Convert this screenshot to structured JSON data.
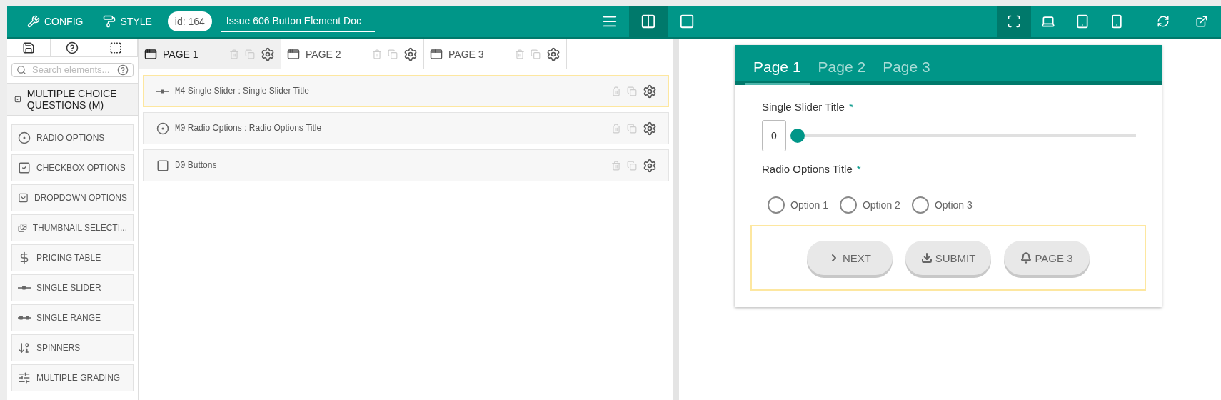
{
  "toolbar": {
    "config_label": "CONFIG",
    "style_label": "STYLE",
    "id_badge": "id: 164",
    "doc_title": "Issue 606 Button Element Doc",
    "view_buttons": [
      {
        "selected": false
      },
      {
        "selected": true
      },
      {
        "selected": false
      }
    ],
    "device_buttons": [
      {
        "selected": true
      },
      {
        "selected": false
      },
      {
        "selected": false
      },
      {
        "selected": false
      }
    ]
  },
  "sidebar": {
    "tool_buttons": [
      {
        "selected": false
      },
      {
        "selected": false
      },
      {
        "selected": false
      }
    ],
    "search_placeholder": "Search elements...",
    "category": {
      "label": "MULTIPLE CHOICE QUESTIONS (M)",
      "checked": true
    },
    "elements": [
      "RADIO OPTIONS",
      "CHECKBOX OPTIONS",
      "DROPDOWN OPTIONS",
      "THUMBNAIL SELECTI...",
      "PRICING TABLE",
      "SINGLE SLIDER",
      "SINGLE RANGE",
      "SPINNERS",
      "MULTIPLE GRADING"
    ]
  },
  "editor": {
    "tabs": [
      {
        "label": "PAGE 1",
        "selected": true
      },
      {
        "label": "PAGE 2",
        "selected": false
      },
      {
        "label": "PAGE 3",
        "selected": false
      }
    ],
    "rows": [
      {
        "code": "M4",
        "text": "Single Slider : Single Slider Title",
        "selected": true
      },
      {
        "code": "M0",
        "text": "Radio Options : Radio Options Title",
        "selected": false
      },
      {
        "code": "D0",
        "text": "Buttons",
        "selected": false
      }
    ]
  },
  "preview": {
    "tabs": [
      {
        "label": "Page 1",
        "selected": true
      },
      {
        "label": "Page 2",
        "selected": false
      },
      {
        "label": "Page 3",
        "selected": false
      }
    ],
    "slider": {
      "title": "Single Slider Title",
      "required_mark": "*",
      "value": "0",
      "level": 0
    },
    "radio": {
      "title": "Radio Options Title",
      "required_mark": "*",
      "options": [
        {
          "label": "Option 1",
          "selected": false
        },
        {
          "label": "Option 2",
          "selected": false
        },
        {
          "label": "Option 3",
          "selected": false
        }
      ]
    },
    "buttons_panel": {
      "selected": true,
      "buttons": [
        "NEXT",
        "SUBMIT",
        "PAGE 3"
      ]
    }
  }
}
